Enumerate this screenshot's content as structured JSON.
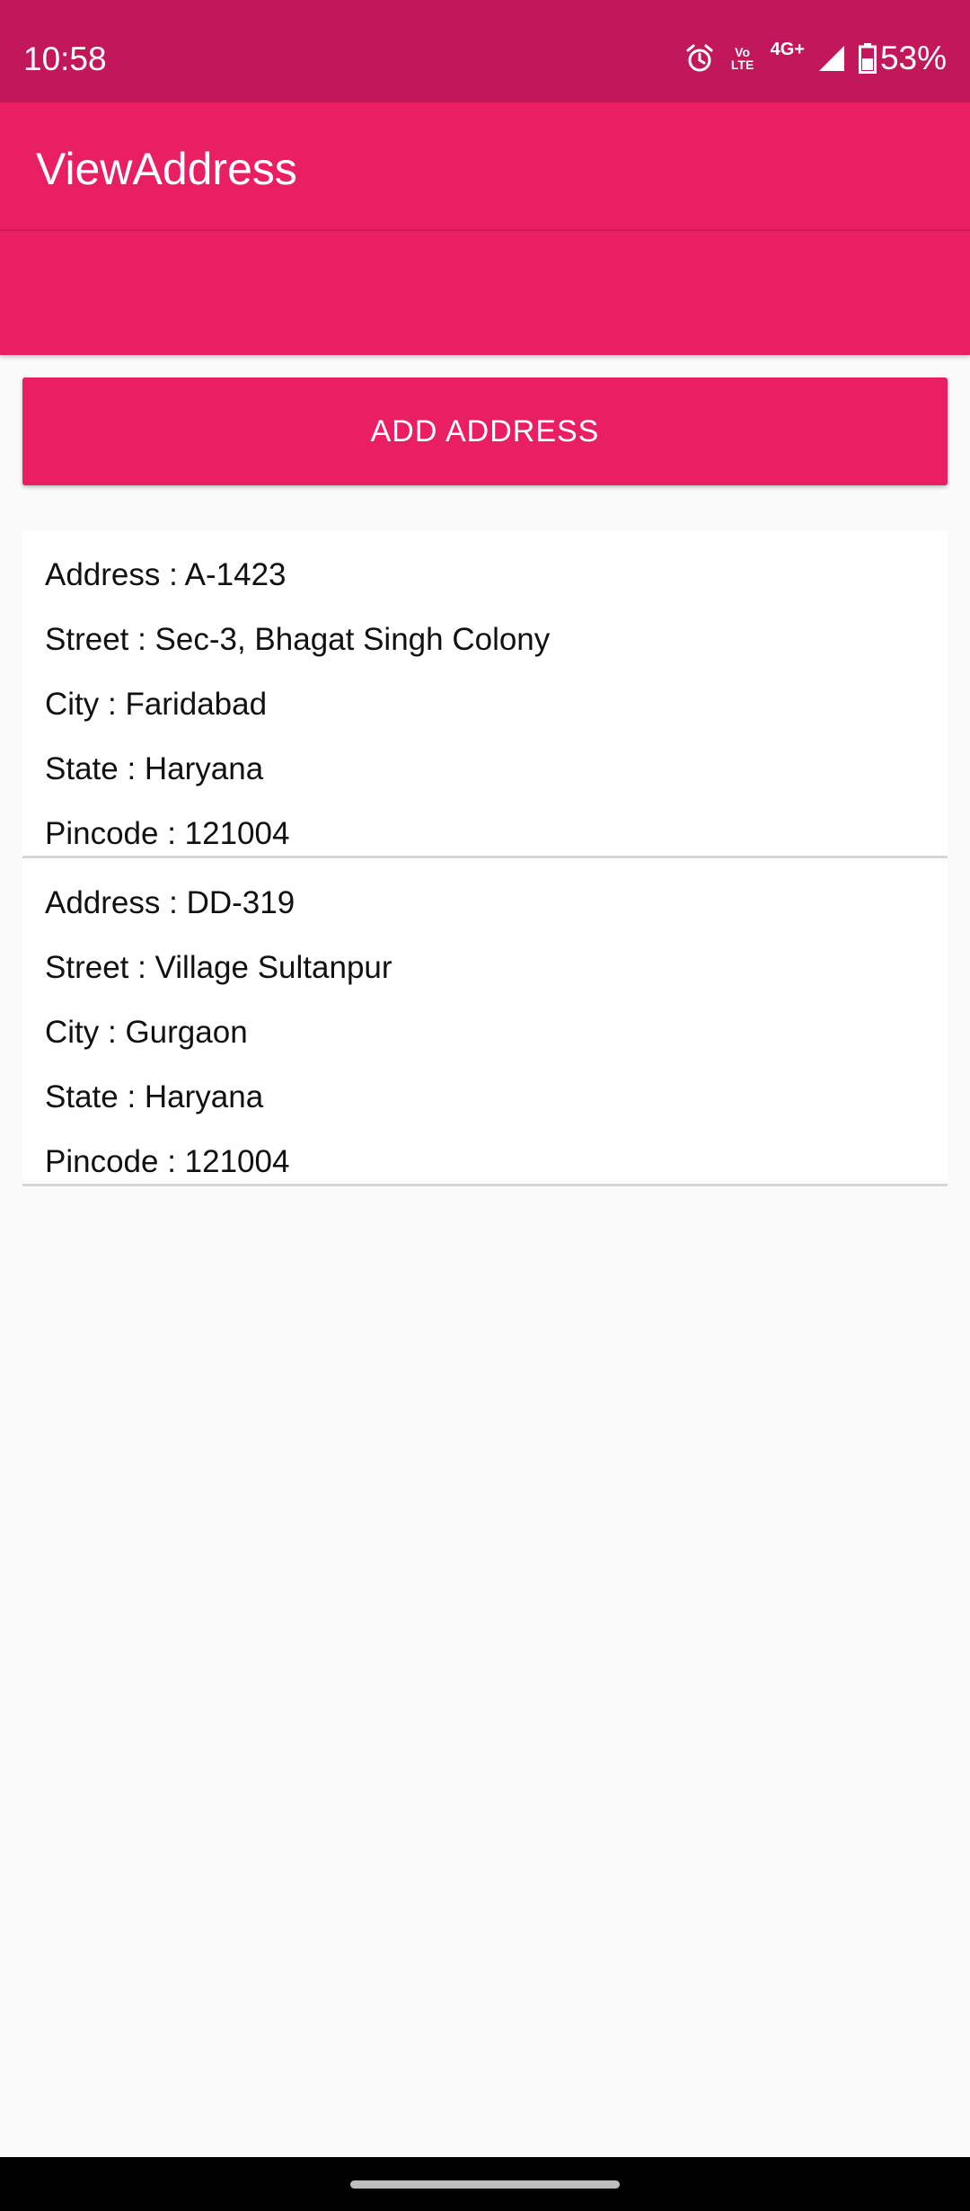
{
  "status_bar": {
    "time": "10:58",
    "volte_top": "Vo",
    "volte_bottom": "LTE",
    "network": "4G+",
    "battery_percent": "53%",
    "icons": [
      "alarm-icon",
      "volte-icon",
      "signal-icon",
      "battery-icon"
    ]
  },
  "app_bar": {
    "title": "ViewAddress"
  },
  "actions": {
    "add_address_label": "ADD ADDRESS"
  },
  "addresses": [
    {
      "address": "Address : A-1423",
      "street": "Street : Sec-3, Bhagat Singh Colony",
      "city": "City : Faridabad",
      "state": "State : Haryana",
      "pincode": "Pincode : 121004"
    },
    {
      "address": "Address : DD-319",
      "street": "Street : Village Sultanpur",
      "city": "City : Gurgaon",
      "state": "State : Haryana",
      "pincode": "Pincode : 121004"
    }
  ],
  "colors": {
    "status_bar": "#c2185b",
    "primary": "#e91e63",
    "background": "#fafafa",
    "card": "#ffffff",
    "text": "#111111"
  }
}
